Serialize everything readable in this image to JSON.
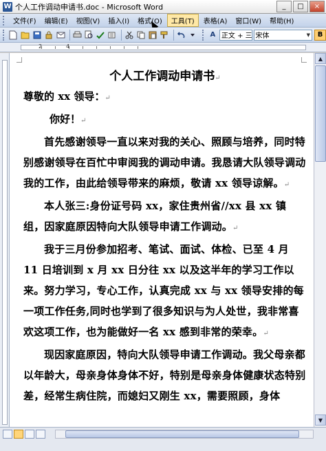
{
  "window": {
    "title": "个人工作调动申请书.doc - Microsoft Word",
    "app_icon_glyph": "W",
    "buttons": {
      "minimize": "_",
      "maximize": "□",
      "close": "×"
    }
  },
  "menu": {
    "items": [
      {
        "label": "文件(F)"
      },
      {
        "label": "编辑(E)"
      },
      {
        "label": "视图(V)"
      },
      {
        "label": "插入(I)"
      },
      {
        "label": "格式(O)"
      },
      {
        "label": "工具(T)",
        "active": true
      },
      {
        "label": "表格(A)"
      },
      {
        "label": "窗口(W)"
      },
      {
        "label": "帮助(H)"
      }
    ]
  },
  "toolbar": {
    "style_value": "正文 + 三号",
    "font_value": "宋体",
    "bold_label": "B",
    "icons": [
      "new-icon",
      "open-icon",
      "save-icon",
      "permission-icon",
      "email-icon",
      "print-icon",
      "preview-icon",
      "spelling-icon",
      "research-icon",
      "cut-icon",
      "copy-icon",
      "paste-icon",
      "format-painter-icon",
      "undo-icon"
    ]
  },
  "ruler": {
    "labels": [
      "2",
      "4"
    ]
  },
  "document": {
    "title": "个人工作调动申请书",
    "salutation": "尊敬的 xx 领导：",
    "hello": "你好！",
    "paragraphs": [
      "首先感谢领导一直以来对我的关心、照顾与培养，同时特别感谢领导在百忙中审阅我的调动申请。我恳请大队领导调动我的工作，由此给领导带来的麻烦，敬请 xx 领导谅解。",
      "本人张三:身份证号码 xx，家住贵州省//xx 县 xx 镇组，因家庭原因特向大队领导申请工作调动。",
      "我于三月份参加招考、笔试、面试、体检、已至 4 月 11 日培训到 x 月 xx 日分往 xx 以及这半年的学习工作以来。努力学习，专心工作，认真完成 xx 与 xx 领导安排的每一项工作任务,同时也学到了很多知识与为人处世，我非常喜欢这项工作，也为能做好一名 xx 感到非常的荣幸。",
      "现因家庭原因，特向大队领导申请工作调动。我父母亲都以年龄大，母亲身体身体不好，特别是母亲身体健康状态特别差，经常生病住院，而媳妇又刚生 xx，需要照顾，身体"
    ],
    "paragraph_mark": "↵"
  },
  "scroll": {
    "up": "▲",
    "down": "▼"
  }
}
